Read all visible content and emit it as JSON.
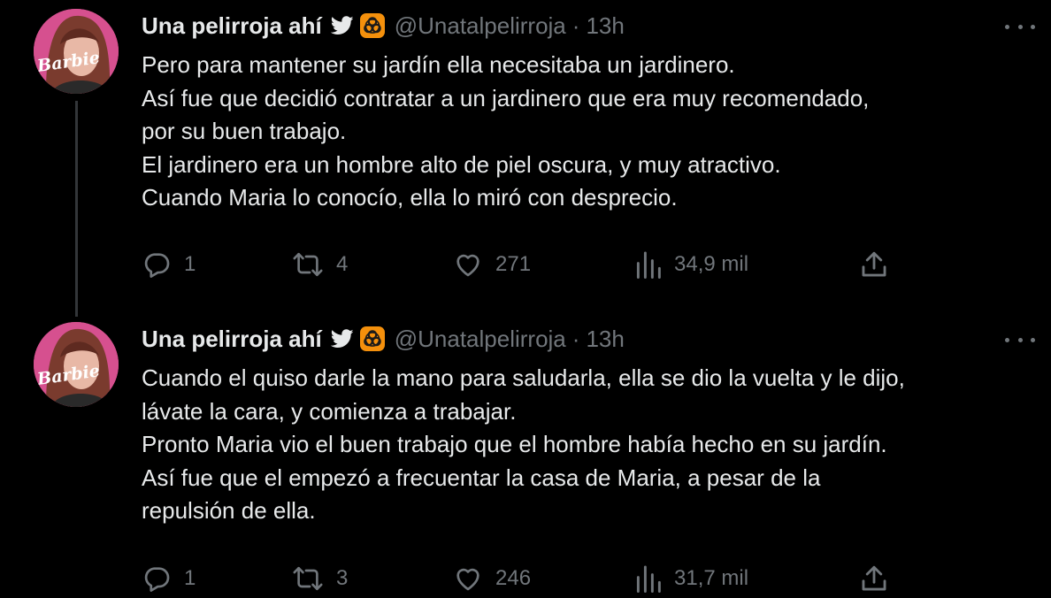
{
  "tweets": [
    {
      "author": {
        "display_name": "Una pelirroja ahí",
        "handle": "@Unatalpelirroja",
        "avatar_text": "Barbie"
      },
      "time": "13h",
      "separator": "·",
      "lines": [
        "Pero para mantener su jardín ella necesitaba un jardinero.",
        "Así fue que decidió contratar a un jardinero que era muy recomendado,",
        "por su buen trabajo.",
        "El jardinero era un hombre alto de piel oscura, y muy atractivo.",
        "Cuando Maria lo conocío, ella lo miró con desprecio."
      ],
      "stats": {
        "replies": "1",
        "retweets": "4",
        "likes": "271",
        "views": "34,9 mil"
      }
    },
    {
      "author": {
        "display_name": "Una pelirroja ahí",
        "handle": "@Unatalpelirroja",
        "avatar_text": "Barbie"
      },
      "time": "13h",
      "separator": "·",
      "lines": [
        "Cuando el quiso darle la mano para saludarla, ella se dio la vuelta y le dijo,",
        "lávate la cara, y comienza a trabajar.",
        "Pronto Maria vio el buen trabajo que el hombre había hecho en su jardín.",
        "Así fue que el empezó a frecuentar la casa de Maria, a pesar de la",
        "repulsión de ella."
      ],
      "stats": {
        "replies": "1",
        "retweets": "3",
        "likes": "246",
        "views": "31,7 mil"
      }
    }
  ],
  "icons": {
    "verified_bird": "bird-icon",
    "emoji_badge": "biohazard-icon",
    "more": "more-icon",
    "reply": "reply-icon",
    "retweet": "retweet-icon",
    "like": "heart-icon",
    "views": "views-icon",
    "share": "share-icon"
  },
  "colors": {
    "background": "#000000",
    "text_primary": "#e7e9ea",
    "text_secondary": "#71767b",
    "thread_line": "#333639",
    "badge_orange": "#f4900c",
    "avatar_pink": "#d6508f"
  }
}
